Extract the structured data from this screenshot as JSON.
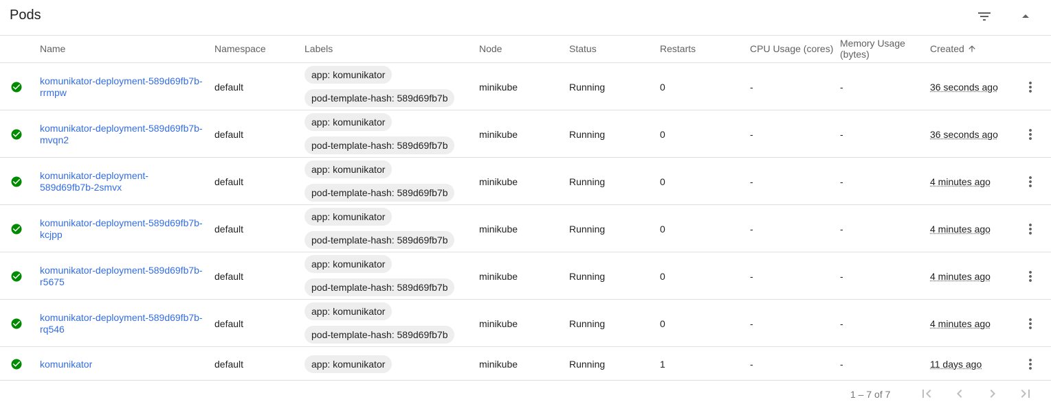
{
  "card": {
    "title": "Pods",
    "filter_icon": "filter-list-icon",
    "collapse_icon": "arrow-drop-up-icon"
  },
  "columns": {
    "name": "Name",
    "namespace": "Namespace",
    "labels": "Labels",
    "node": "Node",
    "status": "Status",
    "restarts": "Restarts",
    "cpu": "CPU Usage (cores)",
    "memory_line1": "Memory Usage",
    "memory_line2": "(bytes)",
    "created": "Created",
    "created_sort": "ascending"
  },
  "rows": [
    {
      "name_line1": "komunikator-deployment-589d69fb7b-",
      "name_line2": "rrmpw",
      "namespace": "default",
      "labels": [
        "app: komunikator",
        "pod-template-hash: 589d69fb7b"
      ],
      "node": "minikube",
      "status": "Running",
      "restarts": "0",
      "cpu": "-",
      "memory": "-",
      "created": "36 seconds ago"
    },
    {
      "name_line1": "komunikator-deployment-589d69fb7b-",
      "name_line2": "mvqn2",
      "namespace": "default",
      "labels": [
        "app: komunikator",
        "pod-template-hash: 589d69fb7b"
      ],
      "node": "minikube",
      "status": "Running",
      "restarts": "0",
      "cpu": "-",
      "memory": "-",
      "created": "36 seconds ago"
    },
    {
      "name_line1": "komunikator-deployment-",
      "name_line2": "589d69fb7b-2smvx",
      "namespace": "default",
      "labels": [
        "app: komunikator",
        "pod-template-hash: 589d69fb7b"
      ],
      "node": "minikube",
      "status": "Running",
      "restarts": "0",
      "cpu": "-",
      "memory": "-",
      "created": "4 minutes ago"
    },
    {
      "name_line1": "komunikator-deployment-589d69fb7b-",
      "name_line2": "kcjpp",
      "namespace": "default",
      "labels": [
        "app: komunikator",
        "pod-template-hash: 589d69fb7b"
      ],
      "node": "minikube",
      "status": "Running",
      "restarts": "0",
      "cpu": "-",
      "memory": "-",
      "created": "4 minutes ago"
    },
    {
      "name_line1": "komunikator-deployment-589d69fb7b-",
      "name_line2": "r5675",
      "namespace": "default",
      "labels": [
        "app: komunikator",
        "pod-template-hash: 589d69fb7b"
      ],
      "node": "minikube",
      "status": "Running",
      "restarts": "0",
      "cpu": "-",
      "memory": "-",
      "created": "4 minutes ago"
    },
    {
      "name_line1": "komunikator-deployment-589d69fb7b-",
      "name_line2": "rq546",
      "namespace": "default",
      "labels": [
        "app: komunikator",
        "pod-template-hash: 589d69fb7b"
      ],
      "node": "minikube",
      "status": "Running",
      "restarts": "0",
      "cpu": "-",
      "memory": "-",
      "created": "4 minutes ago"
    },
    {
      "name_line1": "komunikator",
      "name_line2": "",
      "namespace": "default",
      "labels": [
        "app: komunikator"
      ],
      "node": "minikube",
      "status": "Running",
      "restarts": "1",
      "cpu": "-",
      "memory": "-",
      "created": "11 days ago"
    }
  ],
  "row_status_icon": "check-circle-icon",
  "row_action_icon": "more-vert-icon",
  "colors": {
    "link": "#326de6",
    "success": "#008a00",
    "divider": "#e0e0e0",
    "chip": "#eeeeee"
  },
  "paginator": {
    "range_label": "1 – 7 of 7",
    "first_icon": "first-page-icon",
    "prev_icon": "chevron-left-icon",
    "next_icon": "chevron-right-icon",
    "last_icon": "last-page-icon"
  }
}
